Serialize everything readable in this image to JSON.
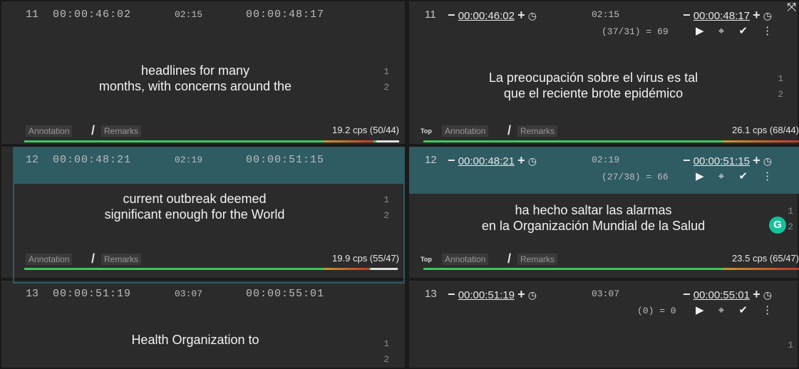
{
  "rows": [
    {
      "number": "11",
      "start": "00:00:46:02",
      "duration": "02:15",
      "end": "00:00:48:17",
      "source_lines": [
        "headlines for many",
        "months, with concerns around the"
      ],
      "target_lines": [
        "La preocupación sobre el virus es tal",
        "que el reciente brote epidémico"
      ],
      "ratio": "(37/31) = 69",
      "source_cps": "19.2 cps (50/44)",
      "target_cps": "26.1 cps (68/44)"
    },
    {
      "number": "12",
      "start": "00:00:48:21",
      "duration": "02:19",
      "end": "00:00:51:15",
      "source_lines": [
        "current outbreak deemed",
        "significant enough for the World"
      ],
      "target_lines": [
        "ha hecho saltar las alarmas",
        "en la Organización Mundial de la Salud"
      ],
      "ratio": "(27/38) = 66",
      "source_cps": "19.9 cps (55/47)",
      "target_cps": "23.5 cps (65/47)"
    },
    {
      "number": "13",
      "start": "00:00:51:19",
      "duration": "03:07",
      "end": "00:00:55:01",
      "source_lines": [
        "Health Organization to"
      ],
      "ratio": "(0) = 0"
    }
  ],
  "line_numbers": [
    "1",
    "2"
  ],
  "labels": {
    "annotation": "Annotation",
    "slash": "/",
    "remarks": "Remarks",
    "top": "Top",
    "minus": "−",
    "plus": "+",
    "clock": "◷",
    "grammarly": "G"
  },
  "icons": {
    "play": "▶",
    "tag": "⌖",
    "check": "✔",
    "more": "⋮",
    "expand": "⤧"
  },
  "colors": {
    "selected_row": "#2f5b62",
    "ok_bar": "#3cc85a",
    "warn_bar": "#c0392b",
    "grammarly": "#15c39a"
  }
}
